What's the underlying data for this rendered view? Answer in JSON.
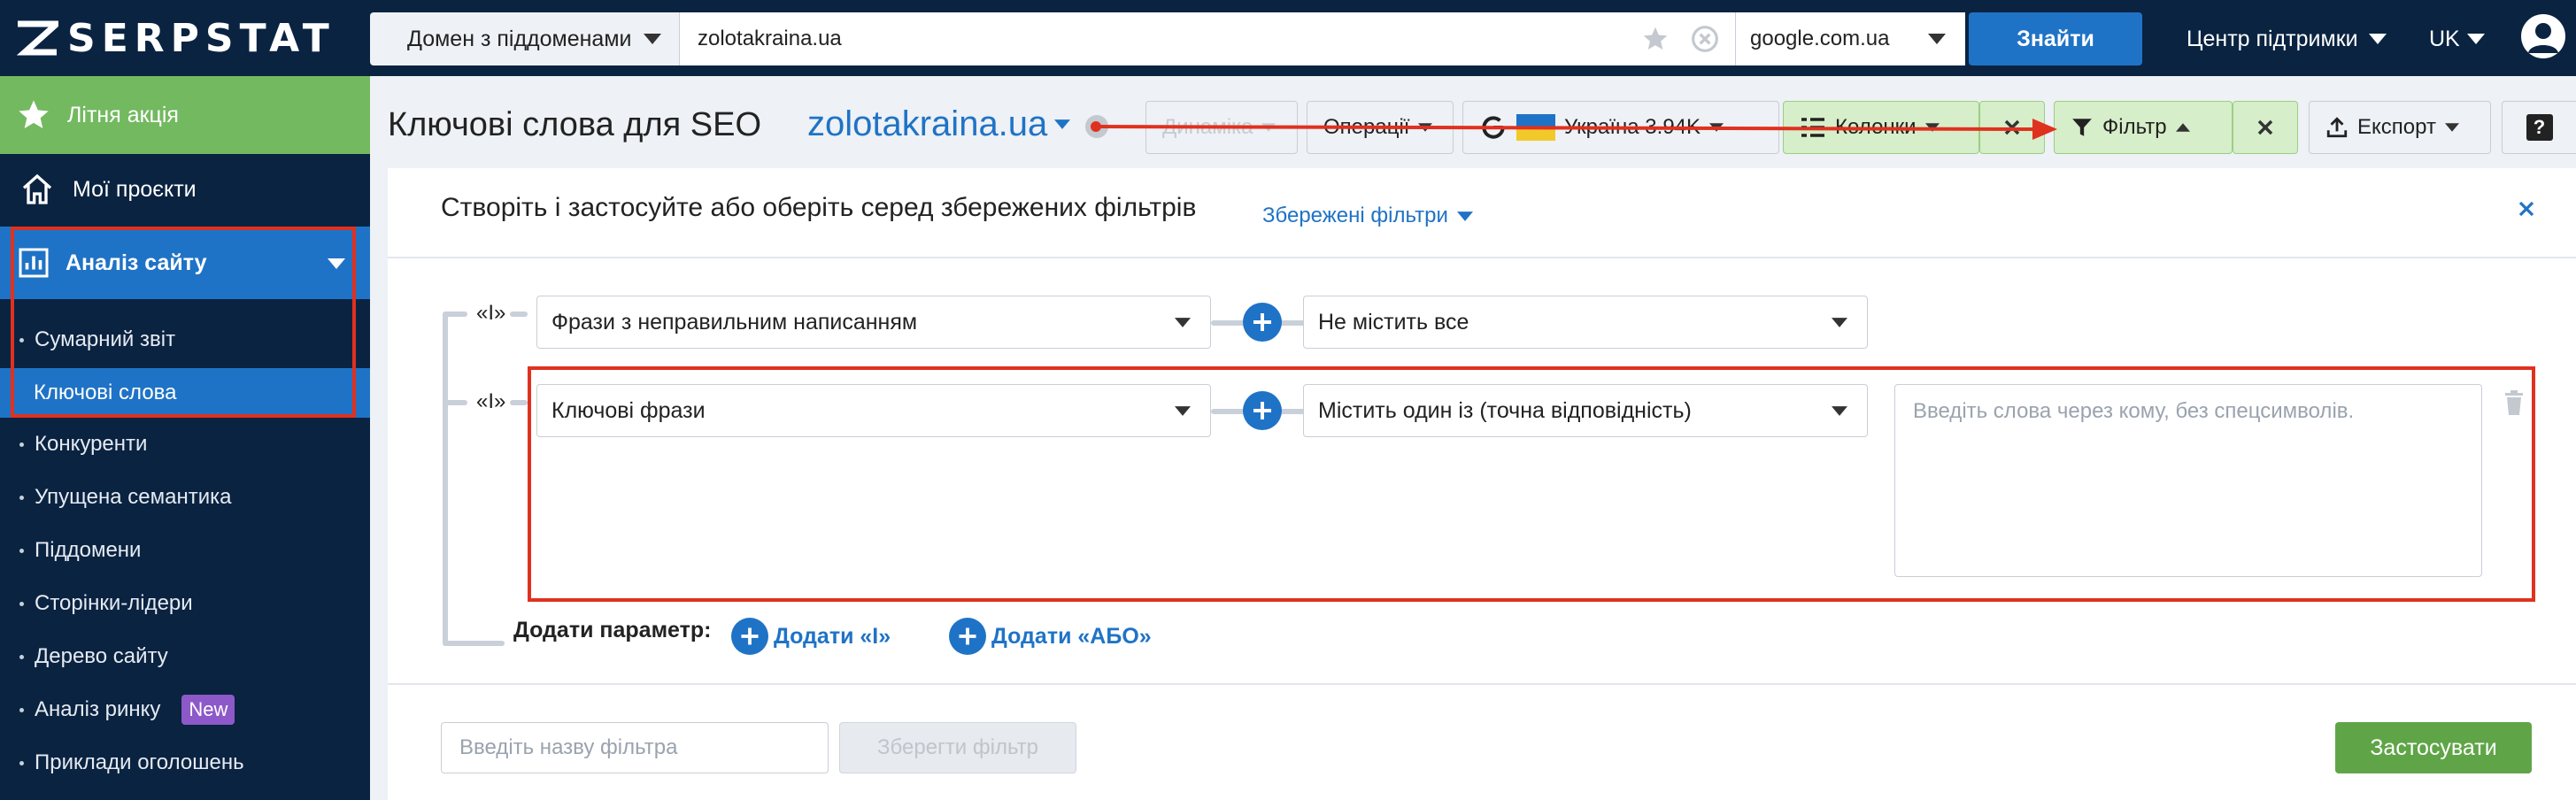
{
  "header": {
    "logo_text": "SERPSTAT",
    "domain_mode": "Домен з піддоменами",
    "search_value": "zolotakraina.ua",
    "search_engine": "google.com.ua",
    "find_label": "Знайти",
    "support_label": "Центр підтримки",
    "language": "UK"
  },
  "sidebar": {
    "promo_label": "Літня акція",
    "projects_label": "Мої проєкти",
    "analysis_label": "Аналіз сайту",
    "items": [
      {
        "label": "Сумарний звіт",
        "active": false
      },
      {
        "label": "Ключові слова",
        "active": true
      },
      {
        "label": "Конкуренти",
        "active": false
      },
      {
        "label": "Упущена семантика",
        "active": false
      },
      {
        "label": "Піддомени",
        "active": false
      },
      {
        "label": "Сторінки-лідери",
        "active": false
      },
      {
        "label": "Дерево сайту",
        "active": false
      },
      {
        "label": "Аналіз ринку",
        "active": false,
        "badge": "New"
      },
      {
        "label": "Приклади оголошень",
        "active": false
      }
    ]
  },
  "page": {
    "title": "Ключові слова для SEO",
    "domain": "zolotakraina.ua"
  },
  "toolbar": {
    "dynamics_label": "Динаміка",
    "operations_label": "Операції",
    "country_label": "Україна 3.94K",
    "columns_label": "Колонки",
    "filter_label": "Фільтр",
    "export_label": "Експорт",
    "help_label": "?"
  },
  "filter_panel": {
    "title": "Створіть і застосуйте або оберіть серед збережених фільтрів",
    "saved_filters_label": "Збережені фільтри",
    "rows": [
      {
        "operator": "«І»",
        "field": "Фрази з неправильним написанням",
        "condition": "Не містить все"
      },
      {
        "operator": "«І»",
        "field": "Ключові фрази",
        "condition": "Містить один із (точна відповідність)",
        "placeholder": "Введіть слова через кому, без спецсимволів."
      }
    ],
    "add_param_label": "Додати параметр:",
    "add_and_label": "Додати «І»",
    "add_or_label": "Додати «АБО»",
    "filter_name_placeholder": "Введіть назву фільтра",
    "save_filter_label": "Зберегти фільтр",
    "apply_label": "Застосувати"
  },
  "colors": {
    "navy": "#0a2341",
    "accent_blue": "#1f73c6",
    "promo_green": "#73b960",
    "apply_green": "#5fa548",
    "highlight_red": "#e0311f",
    "badge_purple": "#8d59c9"
  }
}
